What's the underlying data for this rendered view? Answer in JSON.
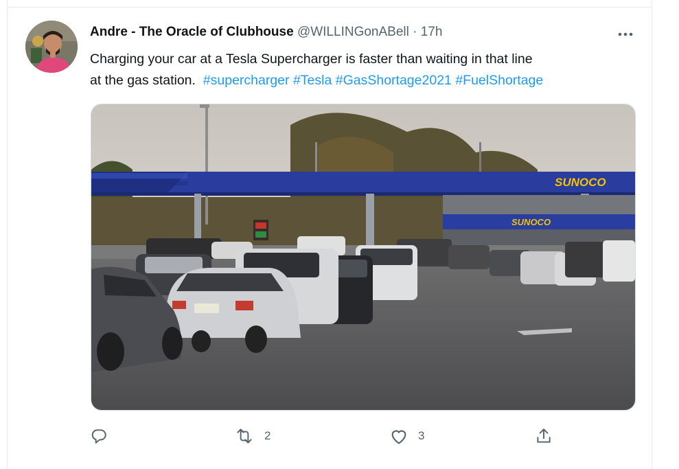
{
  "tweet": {
    "author_name": "Andre - The Oracle of Clubhouse",
    "handle": "@WILLINGonABell",
    "separator": "·",
    "time": "17h",
    "text_line1": "Charging your car at a Tesla Supercharger is faster than waiting in that line",
    "text_line2": "at the gas station.",
    "hashtags": [
      "#supercharger",
      "#Tesla",
      "#GasShortage2021",
      "#FuelShortage"
    ],
    "media_signs": {
      "canopy": "SUNOCO",
      "store": "SUNOCO"
    }
  },
  "actions": {
    "reply": {
      "icon": "reply-icon",
      "count": ""
    },
    "retweet": {
      "icon": "retweet-icon",
      "count": "2"
    },
    "like": {
      "icon": "heart-icon",
      "count": "3"
    },
    "share": {
      "icon": "share-icon",
      "count": ""
    }
  },
  "colors": {
    "link": "#1d9bf0",
    "muted": "#536471",
    "text": "#0f1419",
    "canopy": "#2a3d9e",
    "sign_text": "#f5c400"
  }
}
